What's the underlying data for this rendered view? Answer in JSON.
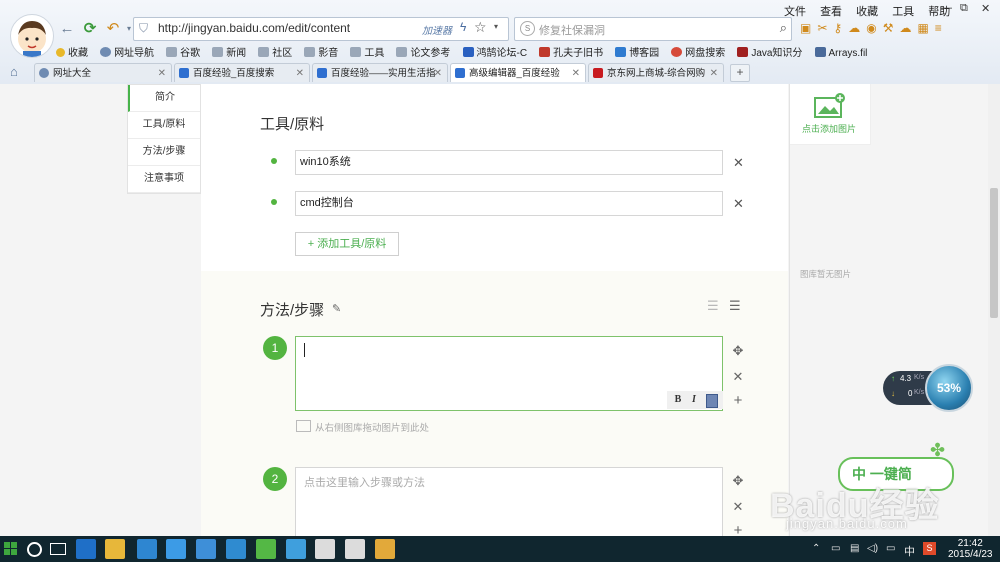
{
  "browser": {
    "menu": [
      "文件",
      "查看",
      "收藏",
      "工具",
      "帮助"
    ],
    "url": "http://jingyan.baidu.com/edit/content",
    "accelerator": "加速器",
    "search_placeholder": "修复社保漏洞",
    "bookmarks": [
      {
        "label": "收藏",
        "color": "#e8b82a"
      },
      {
        "label": "网址导航",
        "color": "#6f8bb2"
      },
      {
        "label": "谷歌",
        "color": "#9aa7b8"
      },
      {
        "label": "新闻",
        "color": "#9aa7b8"
      },
      {
        "label": "社区",
        "color": "#9aa7b8"
      },
      {
        "label": "影音",
        "color": "#9aa7b8"
      },
      {
        "label": "工具",
        "color": "#9aa7b8"
      },
      {
        "label": "论文参考",
        "color": "#9aa7b8"
      },
      {
        "label": "鸿鹄论坛-C",
        "color": "#2a60c0"
      },
      {
        "label": "孔夫子旧书",
        "color": "#c0392b"
      },
      {
        "label": "博客园",
        "color": "#2f7bd0"
      },
      {
        "label": "网盘搜索",
        "color": "#d64a3a"
      },
      {
        "label": "Java知识分",
        "color": "#a02020"
      },
      {
        "label": "Arrays.fil",
        "color": "#4a6a9a"
      }
    ],
    "tabs": [
      {
        "label": "网址大全",
        "color": "#6f8bb2"
      },
      {
        "label": "百度经验_百度搜索",
        "color": "#2f6fd0"
      },
      {
        "label": "百度经验——实用生活指",
        "color": "#2f6fd0"
      },
      {
        "label": "高级编辑器_百度经验",
        "color": "#2f6fd0"
      },
      {
        "label": "京东网上商城-综合网购",
        "color": "#c81b20"
      }
    ],
    "new_tab": "+"
  },
  "sidenav": [
    "简介",
    "工具/原料",
    "方法/步骤",
    "注意事项"
  ],
  "tools_section": {
    "title": "工具/原料",
    "items": [
      "win10系统",
      "cmd控制台"
    ],
    "add_button": "+ 添加工具/原料"
  },
  "steps_section": {
    "title": "方法/步骤",
    "steps": [
      {
        "number": "1",
        "text": "",
        "placeholder": ""
      },
      {
        "number": "2",
        "text": "",
        "placeholder": "点击这里输入步骤或方法"
      }
    ],
    "image_hint": "从右侧图库拖动图片到此处",
    "format_buttons": [
      "B",
      "I"
    ]
  },
  "image_panel": {
    "add_image": "点击添加图片",
    "empty": "图库暂无图片"
  },
  "widgets": {
    "net_up": "4.3",
    "net_down": "0",
    "net_unit": "K/s",
    "net_percent": "53%",
    "one_key": "中 一键简"
  },
  "watermark": {
    "brand": "Baidu经验",
    "site": "jingyan.baidu.com"
  },
  "taskbar": {
    "time": "21:42",
    "date": "2015/4/23",
    "ime": "中",
    "pinned": [
      {
        "name": "outlook-icon",
        "color": "#1f6fc7"
      },
      {
        "name": "explorer-icon",
        "color": "#e7b73a"
      },
      {
        "name": "store-icon",
        "color": "#2e86d1"
      },
      {
        "name": "ie-icon",
        "color": "#3c9be6"
      },
      {
        "name": "app-icon-1",
        "color": "#3e8fd8"
      },
      {
        "name": "app-icon-2",
        "color": "#2f8bd0"
      },
      {
        "name": "app-icon-3",
        "color": "#54b845"
      },
      {
        "name": "photos-icon",
        "color": "#3f9fdd"
      },
      {
        "name": "app-icon-4",
        "color": "#dcdcdc"
      },
      {
        "name": "app-icon-5",
        "color": "#dcdcdc"
      },
      {
        "name": "app-icon-6",
        "color": "#e2a93a"
      }
    ]
  }
}
